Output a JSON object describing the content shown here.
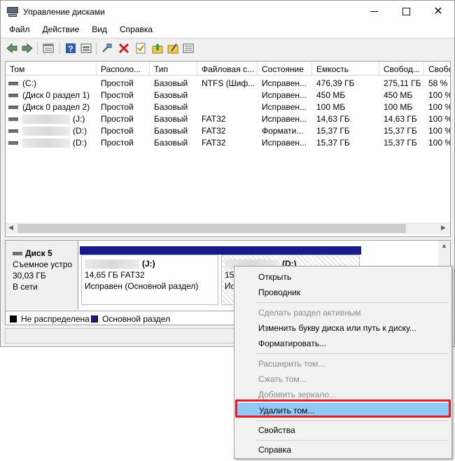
{
  "window": {
    "title": "Управление дисками"
  },
  "menu": [
    "Файл",
    "Действие",
    "Вид",
    "Справка"
  ],
  "table": {
    "headers": [
      "Том",
      "Располо...",
      "Тип",
      "Файловая с...",
      "Состояние",
      "Емкость",
      "Свобод...",
      "Свобо"
    ],
    "rows": [
      {
        "name": "(C:)",
        "layout": "Простой",
        "type": "Базовый",
        "fs": "NTFS (Шиф...",
        "status": "Исправен...",
        "capacity": "476,39 ГБ",
        "free": "275,11 ГБ",
        "pct": "58 %"
      },
      {
        "name": "(Диск 0 раздел 1)",
        "layout": "Простой",
        "type": "Базовый",
        "fs": "",
        "status": "Исправен...",
        "capacity": "450 МБ",
        "free": "450 МБ",
        "pct": "100 %"
      },
      {
        "name": "(Диск 0 раздел 2)",
        "layout": "Простой",
        "type": "Базовый",
        "fs": "",
        "status": "Исправен...",
        "capacity": "100 МБ",
        "free": "100 МБ",
        "pct": "100 %"
      },
      {
        "name": "(J:)",
        "layout": "Простой",
        "type": "Базовый",
        "fs": "FAT32",
        "status": "Исправен...",
        "capacity": "14,63 ГБ",
        "free": "14,63 ГБ",
        "pct": "100 %"
      },
      {
        "name": "(D:)",
        "layout": "Простой",
        "type": "Базовый",
        "fs": "FAT32",
        "status": "Формати...",
        "capacity": "15,37 ГБ",
        "free": "15,37 ГБ",
        "pct": "100 %"
      },
      {
        "name": "(D:)",
        "layout": "Простой",
        "type": "Базовый",
        "fs": "FAT32",
        "status": "Исправен...",
        "capacity": "15,37 ГБ",
        "free": "15,37 ГБ",
        "pct": "100 %"
      }
    ]
  },
  "disk": {
    "title": "Диск 5",
    "kind": "Съемное устро",
    "size": "30,03 ГБ",
    "state": "В сети",
    "part1": {
      "letter": "(J:)",
      "line1": "14,65 ГБ FAT32",
      "line2": "Исправен (Основной раздел)"
    },
    "part2": {
      "letter": "(D:)",
      "line1": "15,",
      "line2": "Ис"
    }
  },
  "legend": {
    "unallocated": "Не распределена",
    "primary": "Основной раздел",
    "unallocated_color": "#000000",
    "primary_color": "#1a1a8a"
  },
  "context_menu": {
    "open": "Открыть",
    "explorer": "Проводник",
    "mark_active": "Сделать раздел активным",
    "change_letter": "Изменить букву диска или путь к диску...",
    "format": "Форматировать...",
    "extend": "Расширить том...",
    "shrink": "Сжать том...",
    "mirror": "Добавить зеркало...",
    "delete": "Удалить том...",
    "properties": "Свойства",
    "help": "Справка"
  },
  "colors": {
    "highlight": "#91c9f7",
    "annotation_box": "#e31b23"
  }
}
